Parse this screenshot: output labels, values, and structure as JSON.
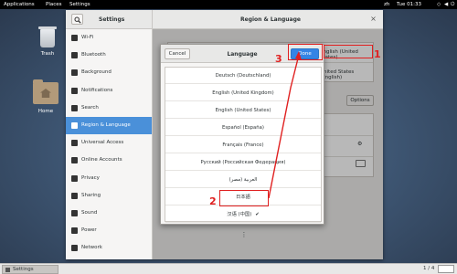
{
  "topbar": {
    "applications": "Applications",
    "places": "Places",
    "settings": "Settings",
    "lang": "zh",
    "clock": "Tue 01:33"
  },
  "desktop": {
    "trash_label": "Trash",
    "home_label": "Home"
  },
  "settings": {
    "title": "Settings",
    "panel_title": "Region & Language",
    "sidebar": [
      {
        "label": "Wi-Fi"
      },
      {
        "label": "Bluetooth"
      },
      {
        "label": "Background"
      },
      {
        "label": "Notifications"
      },
      {
        "label": "Search"
      },
      {
        "label": "Region & Language",
        "selected": true
      },
      {
        "label": "Universal Access"
      },
      {
        "label": "Online Accounts"
      },
      {
        "label": "Privacy"
      },
      {
        "label": "Sharing"
      },
      {
        "label": "Sound"
      },
      {
        "label": "Power"
      },
      {
        "label": "Network"
      }
    ],
    "language_value": "English (United States)",
    "formats_value": "United States (English)",
    "options_label": "Options"
  },
  "dialog": {
    "title": "Language",
    "cancel": "Cancel",
    "done": "Done",
    "languages": [
      "Deutsch (Deutschland)",
      "English (United Kingdom)",
      "English (United States)",
      "Español (España)",
      "Français (France)",
      "Русский (Российская Федерация)",
      "العربية (مصر)",
      "日本語",
      "汉语 (中国)"
    ],
    "selected_mark": "✔",
    "more": "⋮"
  },
  "annotations": {
    "n1": "1",
    "n2": "2",
    "n3": "3",
    "color": "#e02020"
  },
  "taskbar": {
    "window_label": "Settings",
    "pager": "1 / 4"
  }
}
